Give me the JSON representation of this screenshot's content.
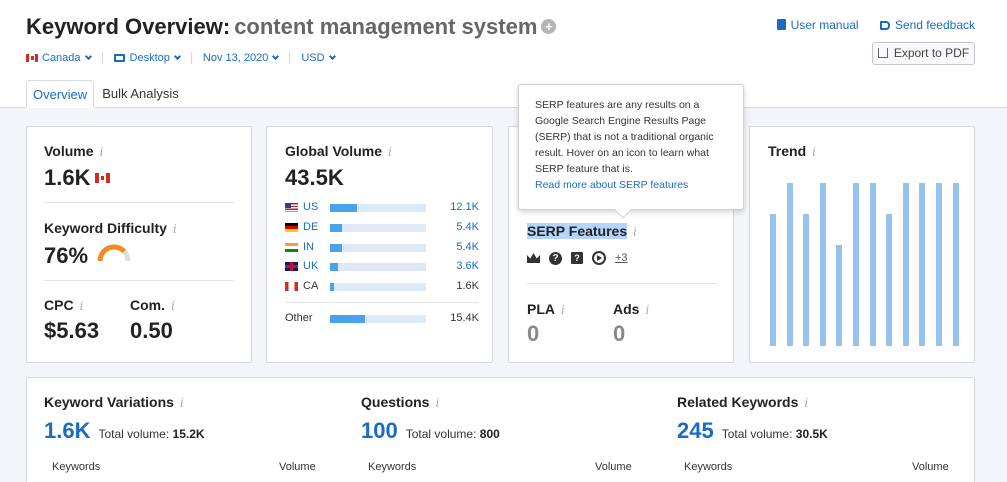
{
  "header": {
    "title": "Keyword Overview:",
    "keyword": "content management system",
    "plus_icon": "plus-circle-icon",
    "user_manual": "User manual",
    "send_feedback": "Send feedback",
    "export": "Export to PDF"
  },
  "filters": {
    "country": "Canada",
    "device": "Desktop",
    "date": "Nov 13, 2020",
    "currency": "USD"
  },
  "tabs": [
    "Overview",
    "Bulk Analysis"
  ],
  "volume": {
    "label": "Volume",
    "value": "1.6K"
  },
  "kd": {
    "label": "Keyword Difficulty",
    "value": "76%",
    "level": 0.76,
    "color": "#f58b1f"
  },
  "cpc": {
    "label": "CPC",
    "value": "$5.63"
  },
  "com": {
    "label": "Com.",
    "value": "0.50"
  },
  "global_volume": {
    "label": "Global Volume",
    "value": "43.5K",
    "rows": [
      {
        "code": "US",
        "value": "12.1K",
        "fraction": 0.28
      },
      {
        "code": "DE",
        "value": "5.4K",
        "fraction": 0.12
      },
      {
        "code": "IN",
        "value": "5.4K",
        "fraction": 0.12
      },
      {
        "code": "UK",
        "value": "3.6K",
        "fraction": 0.08
      },
      {
        "code": "CA",
        "value": "1.6K",
        "fraction": 0.04
      }
    ],
    "other": {
      "label": "Other",
      "value": "15.4K",
      "fraction": 0.36
    }
  },
  "tooltip": {
    "text": "SERP features are any results on a Google Search Engine Results Page (SERP) that is not a traditional organic result. Hover on an icon to learn what SERP feature that is.",
    "link": "Read more about SERP features"
  },
  "serp": {
    "label": "SERP Features",
    "more": "+3",
    "pla_label": "PLA",
    "pla_value": "0",
    "ads_label": "Ads",
    "ads_value": "0"
  },
  "trend": {
    "label": "Trend",
    "values": [
      0.81,
      1.0,
      0.81,
      1.0,
      0.62,
      1.0,
      1.0,
      0.81,
      1.0,
      1.0,
      1.0,
      1.0
    ],
    "color": "#93c4ee"
  },
  "variations": {
    "label": "Keyword Variations",
    "count": "1.6K",
    "total_label": "Total volume:",
    "total": "15.2K",
    "col1": "Keywords",
    "col2": "Volume"
  },
  "questions": {
    "label": "Questions",
    "count": "100",
    "total_label": "Total volume:",
    "total": "800",
    "col1": "Keywords",
    "col2": "Volume"
  },
  "related": {
    "label": "Related Keywords",
    "count": "245",
    "total_label": "Total volume:",
    "total": "30.5K",
    "col1": "Keywords",
    "col2": "Volume"
  },
  "info_glyph": "i"
}
